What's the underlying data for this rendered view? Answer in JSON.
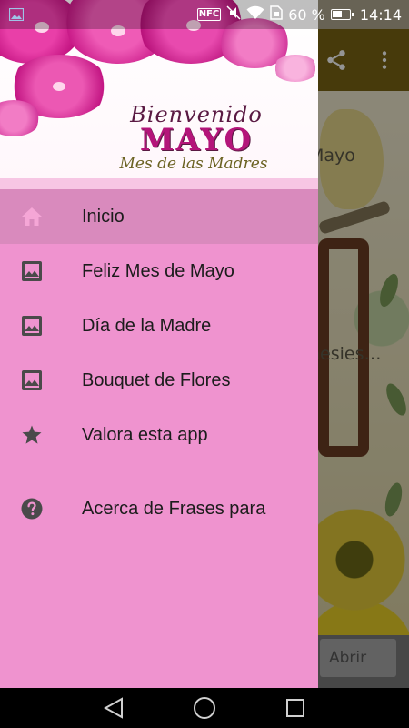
{
  "status_bar": {
    "battery_percent": "60 %",
    "battery_level": 0.6,
    "time": "14:14",
    "nfc_label": "NFC",
    "icons": [
      "image-notification-icon",
      "nfc-icon",
      "mute-icon",
      "wifi-icon",
      "sim-icon",
      "battery-icon"
    ]
  },
  "drawer": {
    "header": {
      "line1": "Bienvenido",
      "line2": "MAYO",
      "line3": "Mes de las Madres"
    },
    "items": [
      {
        "label": "Inicio",
        "icon": "home-icon",
        "active": true
      },
      {
        "label": "Feliz Mes de Mayo",
        "icon": "image-icon"
      },
      {
        "label": "Día de la Madre",
        "icon": "image-icon"
      },
      {
        "label": "Bouquet de Flores",
        "icon": "image-icon"
      },
      {
        "label": "Valora esta app",
        "icon": "star-icon"
      }
    ],
    "secondary_items": [
      {
        "label": "Acerca de Frases para",
        "icon": "help-icon"
      }
    ]
  },
  "background_app": {
    "text_1": "Mayo",
    "text_2": "nesies…",
    "bottom_button": "Abrir",
    "toolbar_icons": [
      "share-icon",
      "more-vert-icon"
    ]
  },
  "nav_bar": {
    "buttons": [
      "back-icon",
      "home-circle-icon",
      "recents-icon"
    ]
  },
  "colors": {
    "drawer_bg": "#ef93cf",
    "active_item_bg": "#d98abd",
    "toolbar": "#7a6514",
    "menu_icon": "#4a4a4a"
  }
}
